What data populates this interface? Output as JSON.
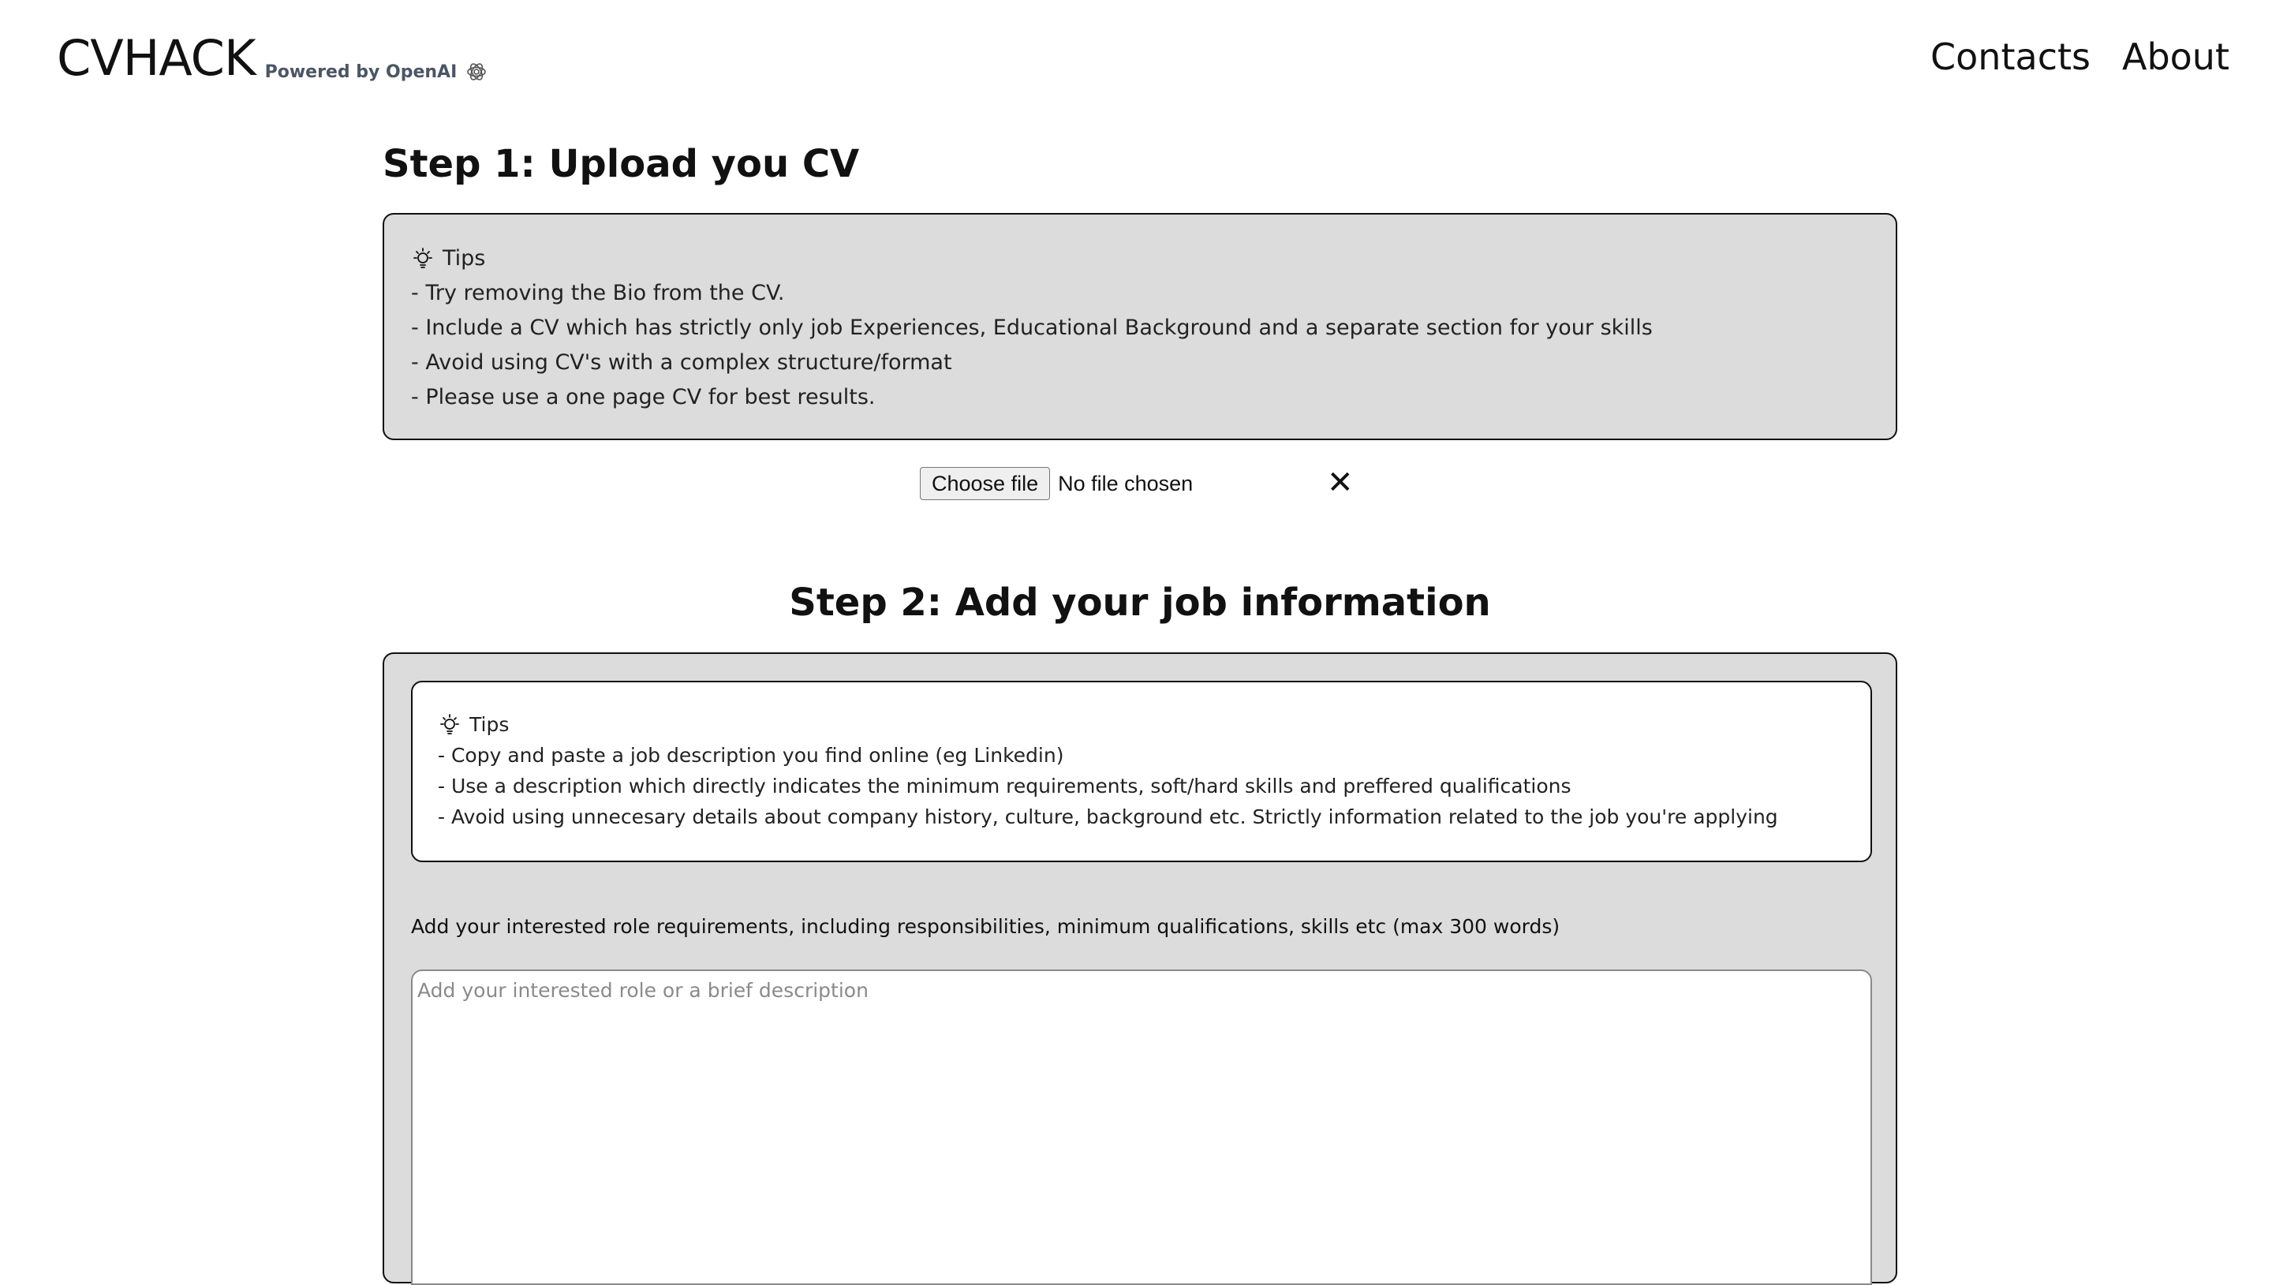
{
  "header": {
    "logo": "CVHACK",
    "powered_by": "Powered by OpenAI",
    "nav": [
      {
        "label": "Contacts"
      },
      {
        "label": "About"
      }
    ]
  },
  "step1": {
    "title": "Step 1: Upload you CV",
    "tips_heading": "Tips",
    "tips": [
      "- Try removing the Bio from the CV.",
      "- Include a CV which has strictly only job Experiences, Educational Background and a separate section for your skills",
      "- Avoid using CV's with a complex structure/format",
      "- Please use a one page CV for best results."
    ],
    "file_button": "Choose file",
    "file_status": "No file chosen",
    "clear_icon": "close-icon"
  },
  "step2": {
    "title": "Step 2: Add your job information",
    "tips_heading": "Tips",
    "tips": [
      "- Copy and paste a job description you find online (eg Linkedin)",
      "- Use a description which directly indicates the minimum requirements, soft/hard skills and preffered qualifications",
      "- Avoid using unnecesary details about company history, culture, background etc. Strictly information related to the job you're applying"
    ],
    "requirements_label": "Add your interested role requirements, including responsibilities, minimum qualifications, skills etc (max 300 words)",
    "textarea_placeholder": "Add your interested role or a brief description",
    "textarea_value": ""
  }
}
